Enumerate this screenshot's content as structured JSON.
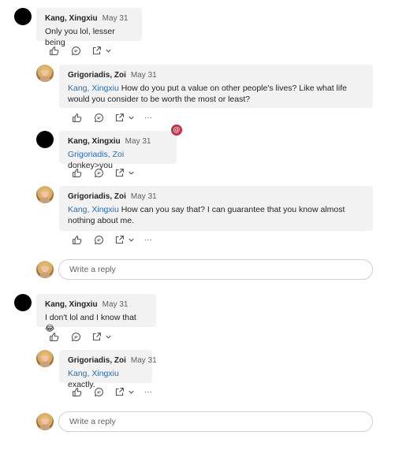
{
  "thread": {
    "messages": [
      {
        "author": "Kang, Xingxiu",
        "date": "May 31",
        "mention": "",
        "text": "Only you lol, lesser being"
      },
      {
        "author": "Grigoriadis, Zoi",
        "date": "May 31",
        "mention": "Kang, Xingxiu",
        "text": "How do you put a value on other people's lives? Like what life would you consider to be worth the most or least?"
      },
      {
        "author": "Kang, Xingxiu",
        "date": "May 31",
        "mention": "Grigoriadis, Zoi",
        "text": "donkey>you"
      },
      {
        "author": "Grigoriadis, Zoi",
        "date": "May 31",
        "mention": "Kang, Xingxiu",
        "text": "How can you say that? I can guarantee that you know almost nothing about me."
      },
      {
        "author": "Kang, Xingxiu",
        "date": "May 31",
        "mention": "",
        "text": "I don't lol and I know that 😂"
      },
      {
        "author": "Grigoriadis, Zoi",
        "date": "May 31",
        "mention": "Kang, Xingxiu",
        "text": "exactly."
      }
    ],
    "reply_placeholder": "Write a reply",
    "mention_badge": "@",
    "more_label": "···"
  },
  "icons": [
    "like-icon",
    "comment-icon",
    "share-icon",
    "chevron-down-icon",
    "more-icon"
  ],
  "colors": {
    "mention": "#2b6cb8",
    "bubble": "#f2f2f2",
    "badge": "#c4314b"
  }
}
